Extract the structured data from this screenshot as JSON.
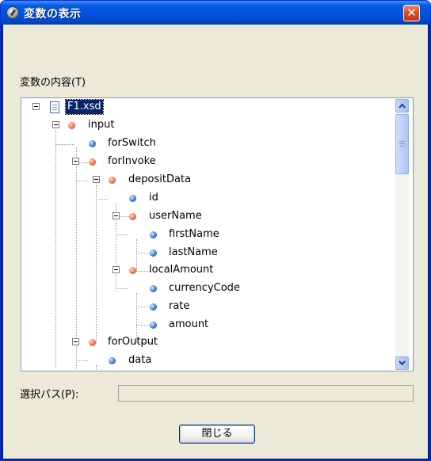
{
  "window": {
    "title": "変数の表示",
    "close_glyph": "✕"
  },
  "contents_label": "変数の内容(T)",
  "tree": {
    "root": "F1.xsd",
    "nodes": [
      {
        "label": "input",
        "type": "complex"
      },
      {
        "label": "forSwitch",
        "type": "simple"
      },
      {
        "label": "forInvoke",
        "type": "complex"
      },
      {
        "label": "depositData",
        "type": "complex"
      },
      {
        "label": "id",
        "type": "simple"
      },
      {
        "label": "userName",
        "type": "complex"
      },
      {
        "label": "firstName",
        "type": "simple"
      },
      {
        "label": "lastName",
        "type": "simple"
      },
      {
        "label": "localAmount",
        "type": "complex"
      },
      {
        "label": "currencyCode",
        "type": "simple"
      },
      {
        "label": "rate",
        "type": "simple"
      },
      {
        "label": "amount",
        "type": "simple"
      },
      {
        "label": "forOutput",
        "type": "complex"
      },
      {
        "label": "data",
        "type": "simple"
      }
    ]
  },
  "path_label": "選択パス(P):",
  "path_value": "",
  "close_button_label": "閉じる",
  "colors": {
    "titlebar": "#0054e3",
    "dialog_bg": "#ece9d8",
    "selection": "#0a246a",
    "complex_node": "#f0734d",
    "simple_node": "#3b7be0"
  }
}
